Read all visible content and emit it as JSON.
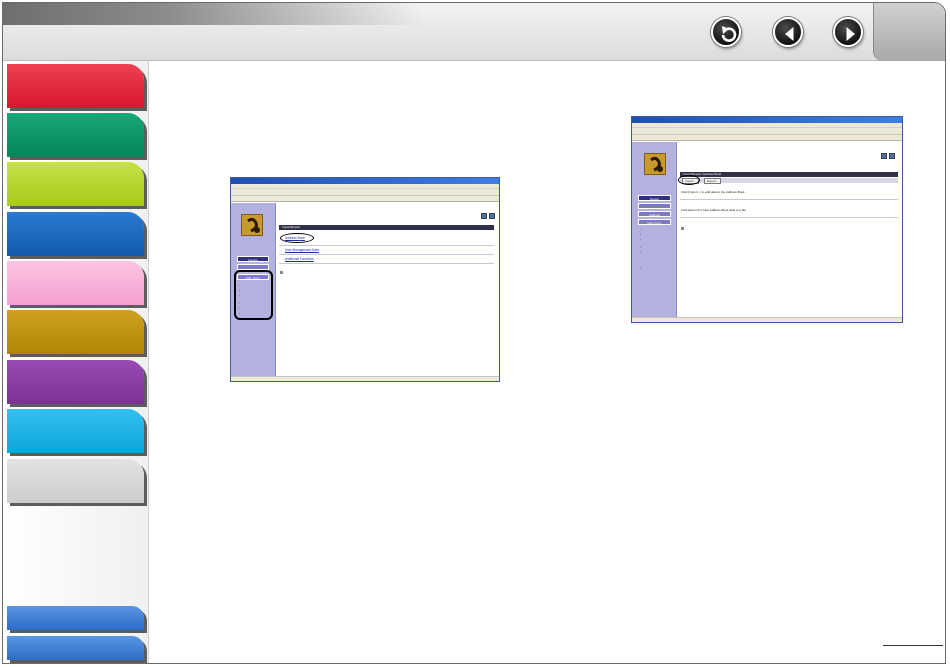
{
  "nav": {
    "back_icon": "return-arrow-icon",
    "prev_icon": "left-triangle-icon",
    "next_icon": "right-triangle-icon"
  },
  "tabs": [
    {
      "name": "red",
      "color": "#e8273b"
    },
    {
      "name": "green",
      "color": "#0b9466"
    },
    {
      "name": "lime",
      "color": "#b6d72b"
    },
    {
      "name": "blue",
      "color": "#1a67bf"
    },
    {
      "name": "pink",
      "color": "#f9b1d8"
    },
    {
      "name": "gold",
      "color": "#c1940c"
    },
    {
      "name": "purple",
      "color": "#8c3ea6"
    },
    {
      "name": "cyan",
      "color": "#1bb3e8"
    },
    {
      "name": "gray",
      "color": "#d7d7d7"
    },
    {
      "name": "bottom-blue-1",
      "color": "#3f7fd8"
    },
    {
      "name": "bottom-blue-2",
      "color": "#3f7fd8"
    }
  ],
  "shot1": {
    "side_device": "Device",
    "side_add_func": "Add. Func.",
    "main_heading": "Import/Export",
    "link_address_book": "Address Book",
    "link_user_mode": "User Management Data",
    "link_additional": "Additional Functions"
  },
  "shot2": {
    "side_device": "Device",
    "side_address": "Address",
    "side_add_func": "Add. Func.",
    "main_heading": "Import/Export: Address Book",
    "btn_import": "Import...",
    "btn_export": "Export...",
    "text_import": "Click [Import...] to add data to the Address Book.",
    "text_export": "Click [Export] to save Address Book data to a file."
  }
}
